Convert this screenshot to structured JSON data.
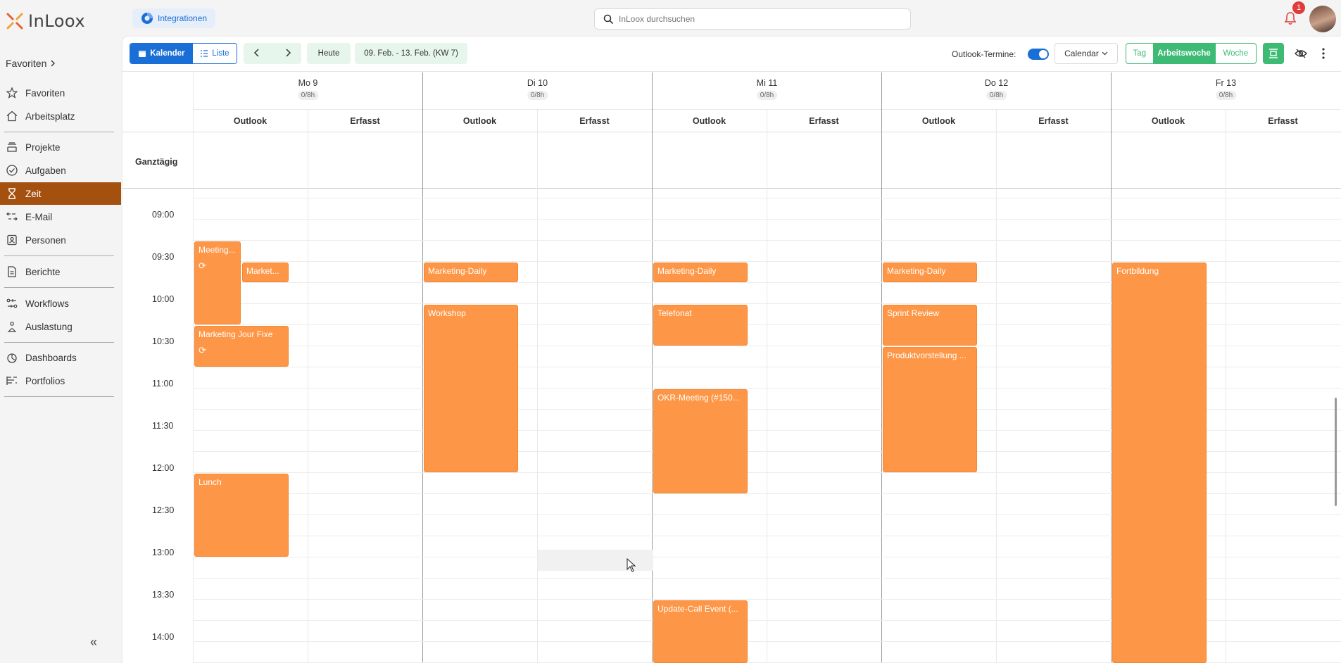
{
  "header": {
    "logo_text": "InLoox",
    "integrations_label": "Integrationen",
    "search_placeholder": "InLoox durchsuchen",
    "notification_count": "1"
  },
  "sidebar": {
    "favorites_header": "Favoriten",
    "items": [
      {
        "label": "Favoriten",
        "icon": "star-icon"
      },
      {
        "label": "Arbeitsplatz",
        "icon": "home-icon"
      },
      {
        "label": "Projekte",
        "icon": "projects-icon"
      },
      {
        "label": "Aufgaben",
        "icon": "check-circle-icon"
      },
      {
        "label": "Zeit",
        "icon": "hourglass-icon"
      },
      {
        "label": "E-Mail",
        "icon": "email-icon"
      },
      {
        "label": "Personen",
        "icon": "contacts-icon"
      },
      {
        "label": "Berichte",
        "icon": "report-icon"
      },
      {
        "label": "Workflows",
        "icon": "workflow-icon"
      },
      {
        "label": "Auslastung",
        "icon": "workload-icon"
      },
      {
        "label": "Dashboards",
        "icon": "dashboard-icon"
      },
      {
        "label": "Portfolios",
        "icon": "portfolio-icon"
      }
    ],
    "active_item": "Zeit"
  },
  "toolbar": {
    "view_calendar": "Kalender",
    "view_list": "Liste",
    "today": "Heute",
    "date_range": "09. Feb. - 13. Feb. (KW 7)",
    "outlook_label": "Outlook-Termine:",
    "outlook_enabled": true,
    "calendar_select": "Calendar",
    "range_day": "Tag",
    "range_workweek": "Arbeitswoche",
    "range_week": "Woche"
  },
  "calendar": {
    "allday_label": "Ganztägig",
    "sub_outlook": "Outlook",
    "sub_erfasst": "Erfasst",
    "days": [
      {
        "name": "Mo 9",
        "hours": "0/8h"
      },
      {
        "name": "Di 10",
        "hours": "0/8h"
      },
      {
        "name": "Mi 11",
        "hours": "0/8h"
      },
      {
        "name": "Do 12",
        "hours": "0/8h"
      },
      {
        "name": "Fr 13",
        "hours": "0/8h"
      }
    ],
    "times": [
      "09:00",
      "09:30",
      "10:00",
      "10:30",
      "11:00",
      "11:30",
      "12:00",
      "12:30",
      "13:00",
      "13:30",
      "14:00"
    ],
    "events": [
      {
        "title": "Meeting...",
        "day": 0,
        "recurring": true
      },
      {
        "title": "Market...",
        "day": 0,
        "recurring": false
      },
      {
        "title": "Marketing Jour Fixe",
        "day": 0,
        "recurring": true
      },
      {
        "title": "Lunch",
        "day": 0,
        "recurring": false
      },
      {
        "title": "Marketing-Daily",
        "day": 1,
        "recurring": false
      },
      {
        "title": "Workshop",
        "day": 1,
        "recurring": false
      },
      {
        "title": "Marketing-Daily",
        "day": 2,
        "recurring": false
      },
      {
        "title": "Telefonat",
        "day": 2,
        "recurring": false
      },
      {
        "title": "OKR-Meeting (#150...",
        "day": 2,
        "recurring": false
      },
      {
        "title": "Update-Call Event (...",
        "day": 2,
        "recurring": false
      },
      {
        "title": "Marketing-Daily",
        "day": 3,
        "recurring": false
      },
      {
        "title": "Sprint Review",
        "day": 3,
        "recurring": false
      },
      {
        "title": "Produktvorstellung ...",
        "day": 3,
        "recurring": false
      },
      {
        "title": "Fortbildung",
        "day": 4,
        "recurring": false
      }
    ]
  },
  "colors": {
    "accent_blue": "#1a6fd6",
    "accent_green": "#3dbb74",
    "active_nav": "#a4500f",
    "event_orange": "#fd9747"
  }
}
